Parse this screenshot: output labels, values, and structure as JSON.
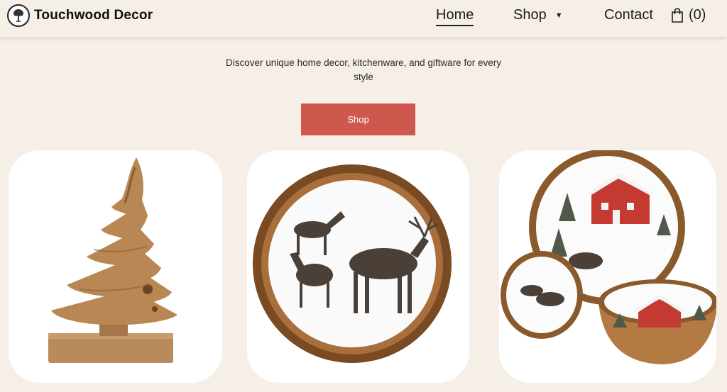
{
  "header": {
    "brand_name": "Touchwood Decor",
    "nav": {
      "home": "Home",
      "shop": "Shop",
      "contact": "Contact"
    },
    "cart_count": "(0)"
  },
  "hero": {
    "tagline": "Discover unique home decor, kitchenware, and giftware for every style",
    "button_label": "Shop",
    "button_color": "#cf584e"
  },
  "colors": {
    "background": "#f6efe8",
    "card": "#ffffff",
    "wood": "#a87a4e"
  }
}
